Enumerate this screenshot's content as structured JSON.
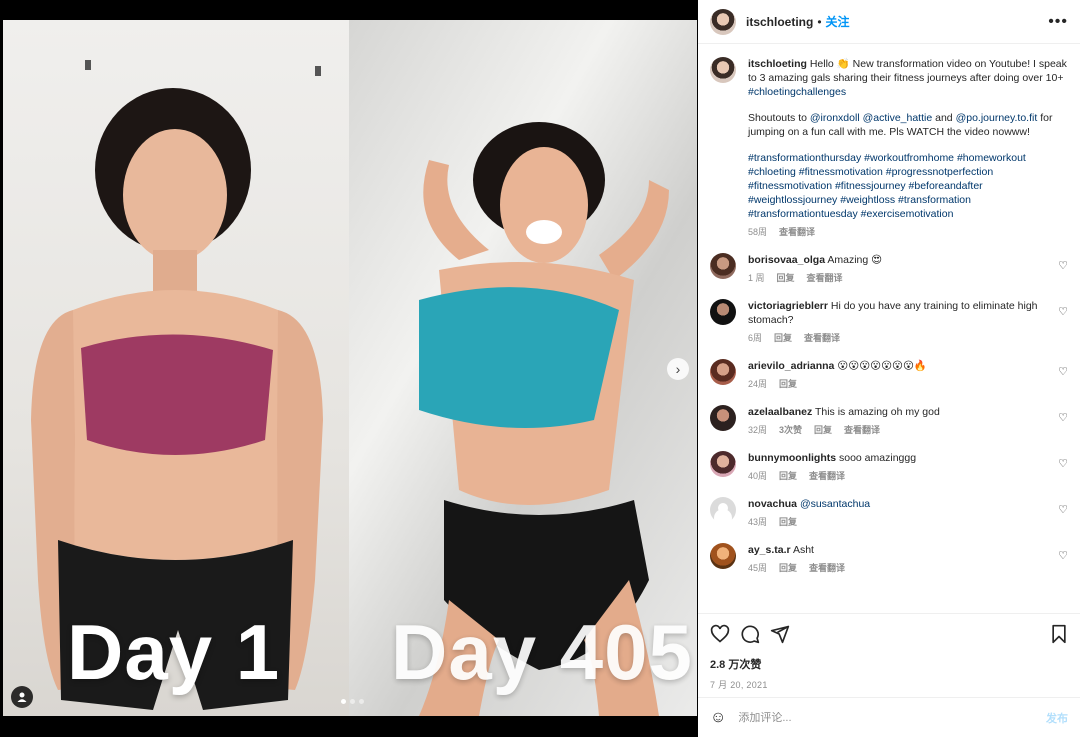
{
  "post": {
    "username": "itschloeting",
    "follow_label": "关注",
    "separator": "•",
    "more_label": "•••",
    "image_labels": {
      "left": "Day 1",
      "right": "Day 405"
    },
    "caption": {
      "text_1": "Hello 👏 New transformation video on Youtube! I speak to 3 amazing gals sharing their fitness journeys after doing over 10+ ",
      "hashtag_1": "#chloetingchallenges",
      "text_2": "Shoutouts to ",
      "mention_1": "@ironxdoll",
      "mention_2": "@active_hattie",
      "and_word": "and",
      "mention_3": "@po.journey.to.fit",
      "text_3": "for jumping on a fun call with me. Pls WATCH the video nowww!",
      "hashtags": [
        "#transformationthursday",
        "#workoutfromhome",
        "#homeworkout",
        "#chloeting",
        "#fitnessmotivation",
        "#progressnotperfection",
        "#fitnessmotivation",
        "#fitnessjourney",
        "#beforeandafter",
        "#weightlossjourney",
        "#weightloss",
        "#transformation",
        "#transformationtuesday",
        "#exercisemotivation"
      ],
      "time": "58周",
      "translate": "查看翻译"
    },
    "comments": [
      {
        "user": "borisovaa_olga",
        "text": "Amazing 😍",
        "time": "1 周",
        "reply": "回复",
        "translate": "查看翻译"
      },
      {
        "user": "victoriagrieblerr",
        "text": "Hi do you have any training to eliminate high stomach?",
        "time": "6周",
        "reply": "回复",
        "translate": "查看翻译"
      },
      {
        "user": "arievilo_adrianna",
        "text": "😮😮😮😮😮😮😮🔥",
        "time": "24周",
        "reply": "回复"
      },
      {
        "user": "azelaalbanez",
        "text": "This is amazing oh my god",
        "time": "32周",
        "likes": "3次赞",
        "reply": "回复",
        "translate": "查看翻译"
      },
      {
        "user": "bunnymoonlights",
        "text": "sooo amazinggg",
        "time": "40周",
        "reply": "回复",
        "translate": "查看翻译"
      },
      {
        "user": "novachua",
        "mention": "@susantachua",
        "time": "43周",
        "reply": "回复"
      },
      {
        "user": "ay_s.ta.r",
        "text": "Asht",
        "time": "45周",
        "reply": "回复",
        "translate": "查看翻译"
      }
    ],
    "likes": "2.8 万次赞",
    "date": "7 月 20, 2021",
    "composer": {
      "placeholder": "添加评论...",
      "post_label": "发布"
    }
  }
}
